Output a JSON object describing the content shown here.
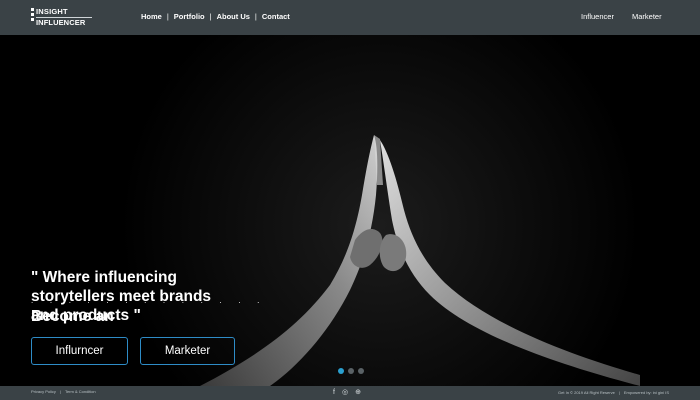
{
  "brand": {
    "line1": "INSIGHT",
    "line2": "INFLUENCER"
  },
  "nav": {
    "items": [
      "Home",
      "Portfolio",
      "About Us",
      "Contact"
    ],
    "separator": "|"
  },
  "right_nav": {
    "influencer": "Influencer",
    "marketer": "Marketer"
  },
  "hero": {
    "quote": "\" Where influencing storytellers meet brands and products \"",
    "dots": ". . . . . . . . . . . . .",
    "become": "Become an",
    "buttons": {
      "influencer": "Influrncer",
      "marketer": "Marketer"
    },
    "carousel_active": 1,
    "carousel_count": 3
  },
  "footer": {
    "privacy": "Privacy Policy",
    "sep": "|",
    "terms": "Term & Condition",
    "copyright": "Get In © 2019 All Right Reserve",
    "empowered": "Empowered by: ini gini IS",
    "social_icons": [
      "facebook-icon",
      "instagram-icon",
      "globe-icon"
    ]
  },
  "colors": {
    "header_bg": "#3a4246",
    "accent": "#2e8cc7",
    "hero_bg": "#000000"
  }
}
